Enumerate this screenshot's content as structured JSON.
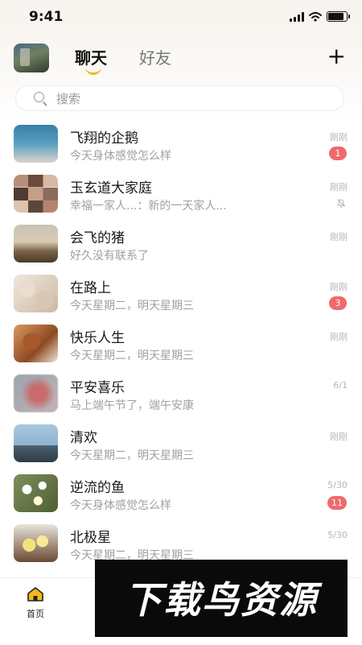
{
  "status_bar": {
    "time": "9:41"
  },
  "header": {
    "tabs": [
      {
        "label": "聊天",
        "active": true
      },
      {
        "label": "好友",
        "active": false
      }
    ],
    "add_label": "+",
    "accent_color": "#f1b81d"
  },
  "search": {
    "placeholder": "搜索",
    "value": ""
  },
  "conversations": [
    {
      "name": "飞翔的企鹅",
      "message": "今天身体感觉怎么样",
      "time": "刚刚",
      "badge": "1"
    },
    {
      "name": "玉玄道大家庭",
      "message": "幸福一家人...：新的一天家人...",
      "time": "刚刚",
      "muted": true,
      "icon": "mute-bell-icon"
    },
    {
      "name": "会飞的猪",
      "message": "好久没有联系了",
      "time": "刚刚"
    },
    {
      "name": "在路上",
      "message": "今天星期二，明天星期三",
      "time": "刚刚",
      "badge": "3"
    },
    {
      "name": "快乐人生",
      "message": "今天星期二，明天星期三",
      "time": "刚刚"
    },
    {
      "name": "平安喜乐",
      "message": "马上端午节了，端午安康",
      "time": "6/1"
    },
    {
      "name": "清欢",
      "message": "今天星期二，明天星期三",
      "time": "刚刚"
    },
    {
      "name": "逆流的鱼",
      "message": "今天身体感觉怎么样",
      "time": "5/30",
      "badge": "11"
    },
    {
      "name": "北极星",
      "message": "今天星期二，明天星期三",
      "time": "5/30"
    }
  ],
  "tabbar": {
    "home_label": "首页",
    "home_icon": "home-icon"
  },
  "watermark": {
    "text": "下载鸟资源"
  },
  "colors": {
    "badge": "#f06a6a"
  }
}
